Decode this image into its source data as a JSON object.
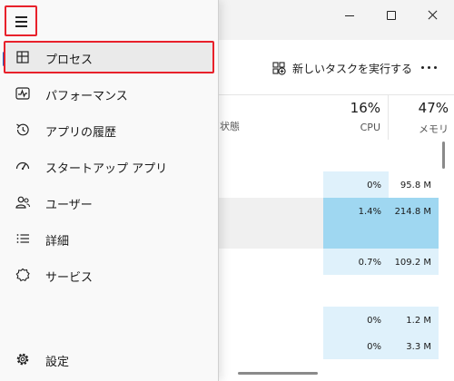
{
  "nav": {
    "items": [
      {
        "label": "プロセス"
      },
      {
        "label": "パフォーマンス"
      },
      {
        "label": "アプリの履歴"
      },
      {
        "label": "スタートアップ アプリ"
      },
      {
        "label": "ユーザー"
      },
      {
        "label": "詳細"
      },
      {
        "label": "サービス"
      }
    ],
    "settings": "設定",
    "selected_index": 0
  },
  "toolbar": {
    "new_task": "新しいタスクを実行する"
  },
  "columns": {
    "status": "状態",
    "cpu": {
      "percent": "16%",
      "label": "CPU"
    },
    "memory": {
      "percent": "47%",
      "label": "メモリ"
    }
  },
  "rows": [
    {
      "cpu": "0%",
      "mem": "95.8 M"
    },
    {
      "cpu": "1.4%",
      "mem": "214.8 M"
    },
    {
      "cpu": "0.7%",
      "mem": "109.2 M"
    },
    {
      "cpu": "0%",
      "mem": "1.2 M"
    },
    {
      "cpu": "0%",
      "mem": "3.3 M"
    }
  ],
  "colors": {
    "highlight_red": "#e8212b",
    "selection_indicator": "#1f5fbf",
    "cell_light": "#dff1fb",
    "cell_strong": "#9fd7f1"
  }
}
